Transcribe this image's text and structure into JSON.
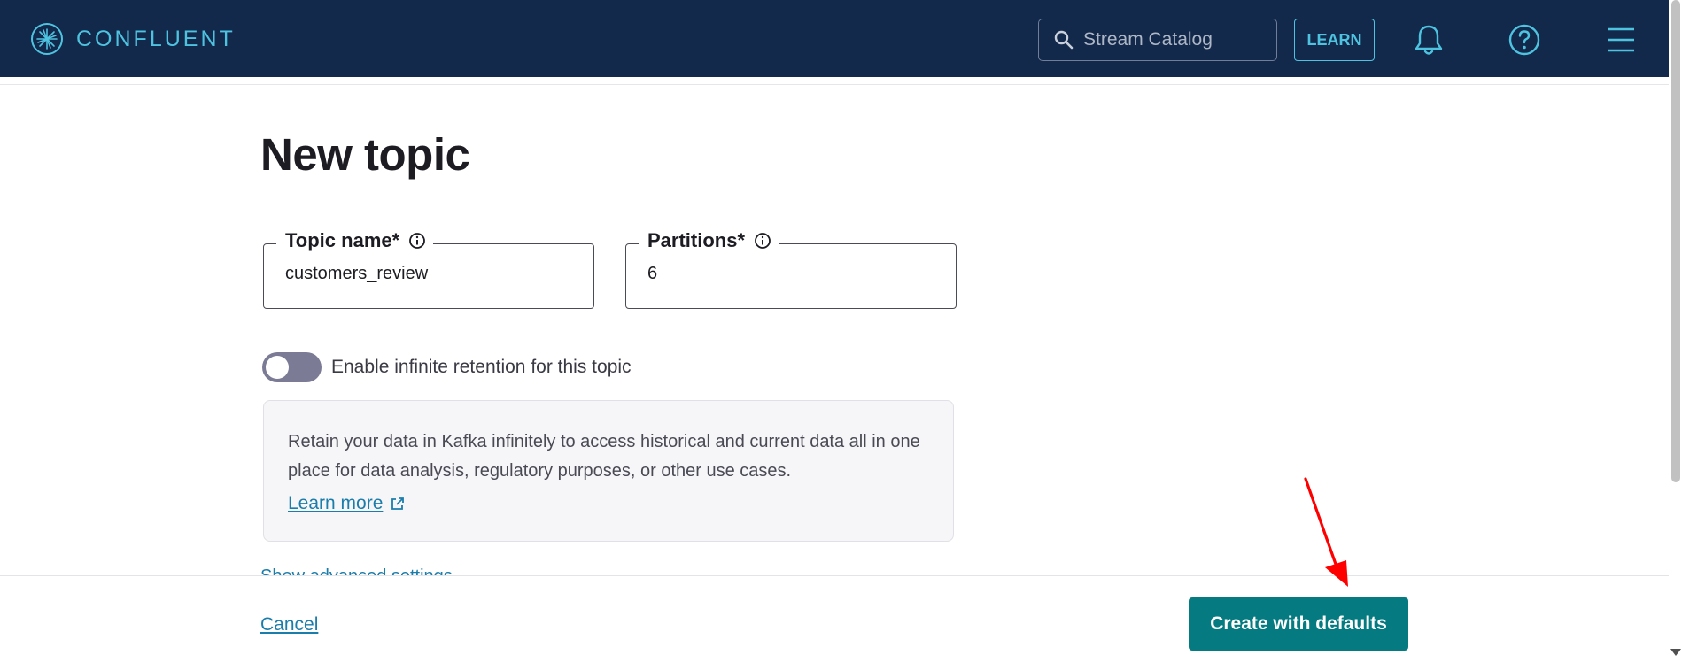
{
  "header": {
    "brand": "CONFLUENT",
    "search_placeholder": "Stream Catalog",
    "learn_label": "LEARN",
    "icons": [
      "confluent-logo-icon",
      "search-icon",
      "bell-icon",
      "help-icon",
      "menu-icon"
    ]
  },
  "page": {
    "title": "New topic"
  },
  "form": {
    "topic_name": {
      "label": "Topic name*",
      "value": "customers_review"
    },
    "partitions": {
      "label": "Partitions*",
      "value": "6"
    },
    "retention_toggle": {
      "label": "Enable infinite retention for this topic",
      "checked": false
    }
  },
  "info_box": {
    "text": "Retain your data in Kafka infinitely to access historical and current data all in one place for data analysis, regulatory purposes, or other use cases.",
    "link_label": "Learn more"
  },
  "advanced_link": "Show advanced settings",
  "footer": {
    "cancel_label": "Cancel",
    "create_label": "Create with defaults"
  },
  "colors": {
    "header_bg": "#13294b",
    "accent": "#4ec3e0",
    "primary_button": "#057b81",
    "link": "#1a7dab",
    "annotation_arrow": "#ff0000"
  }
}
